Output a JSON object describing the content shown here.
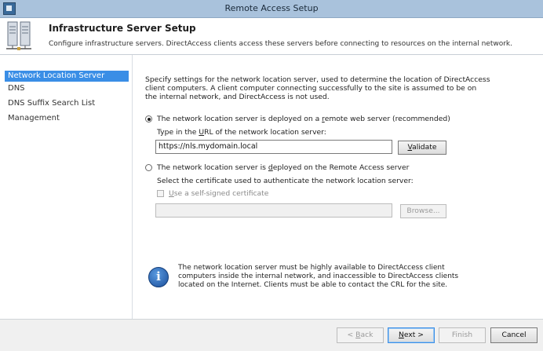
{
  "window": {
    "title": "Remote Access Setup"
  },
  "header": {
    "title": "Infrastructure Server Setup",
    "description": "Configure infrastructure servers. DirectAccess clients access these servers before connecting to resources on the internal network."
  },
  "sidebar": {
    "items": [
      {
        "label": "Network Location Server"
      },
      {
        "label": "DNS"
      },
      {
        "label": "DNS Suffix Search List"
      },
      {
        "label": "Management"
      }
    ]
  },
  "main": {
    "intro": "Specify settings for the network location server, used to determine the location of DirectAccess client computers. A client computer connecting successfully to the site is assumed to be on the internal network, and DirectAccess is not used.",
    "option_remote": {
      "label_pre": "The network location server is deployed on a ",
      "label_key": "r",
      "label_post": "emote web server (recommended)",
      "url_prompt_pre": "Type in the ",
      "url_prompt_key": "U",
      "url_prompt_post": "RL of the network location server:",
      "url_value": "https://nls.mydomain.local",
      "validate_key": "V",
      "validate_rest": "alidate"
    },
    "option_local": {
      "label_pre": "The network location server is ",
      "label_key": "d",
      "label_post": "eployed on the Remote Access server",
      "cert_prompt": "Select the certificate used to authenticate the network location server:",
      "self_signed_key": "U",
      "self_signed_rest": "se a self-signed certificate",
      "cert_value": "",
      "browse_label": "Browse..."
    },
    "info": "The network location server must be highly available to DirectAccess client computers inside the internal network, and inaccessible to DirectAccess clients located on the Internet. Clients must be able to contact the CRL for the site."
  },
  "footer": {
    "back_pre": "< ",
    "back_key": "B",
    "back_rest": "ack",
    "next_key": "N",
    "next_rest": "ext >",
    "finish_label": "Finish",
    "cancel_label": "Cancel"
  }
}
